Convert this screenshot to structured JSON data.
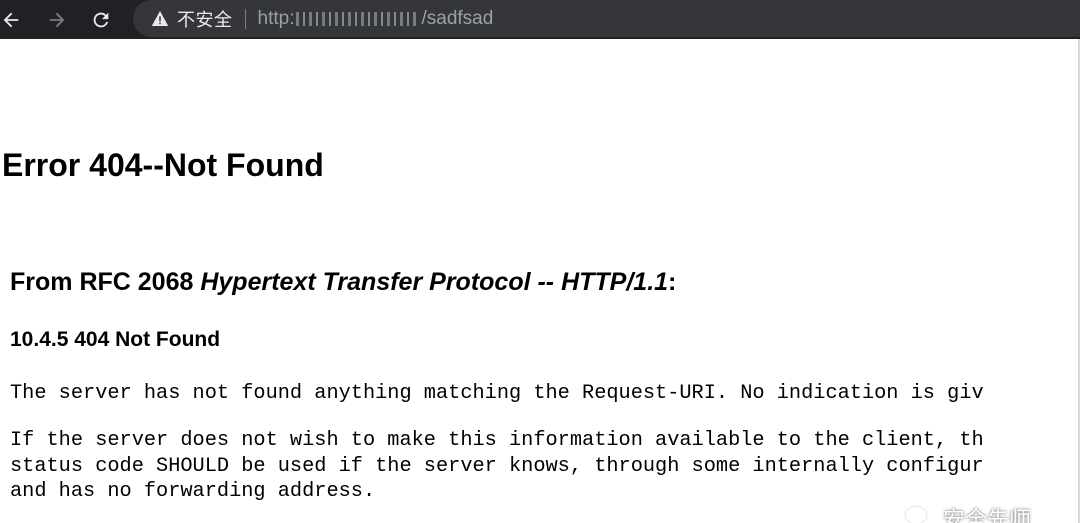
{
  "browser": {
    "security_label": "不安全",
    "url_prefix": "http:",
    "url_suffix": "/sadfsad"
  },
  "page": {
    "title": "Error 404--Not Found",
    "rfc_prefix": "From RFC 2068 ",
    "rfc_title": "Hypertext Transfer Protocol -- HTTP/1.1",
    "rfc_suffix": ":",
    "section": "10.4.5 404 Not Found",
    "paragraph1": "The server has not found anything matching the Request-URI. No indication is giv",
    "paragraph2_line1": "If the server does not wish to make this information available to the client, th",
    "paragraph2_line2": "status code SHOULD be used if the server knows, through some internally configur",
    "paragraph2_line3": "and has no forwarding address."
  },
  "watermark": {
    "text": "安全先师"
  },
  "colors": {
    "toolbar_bg": "#202124",
    "omnibox_bg": "#35363a",
    "url_text": "#9aa0a6"
  }
}
